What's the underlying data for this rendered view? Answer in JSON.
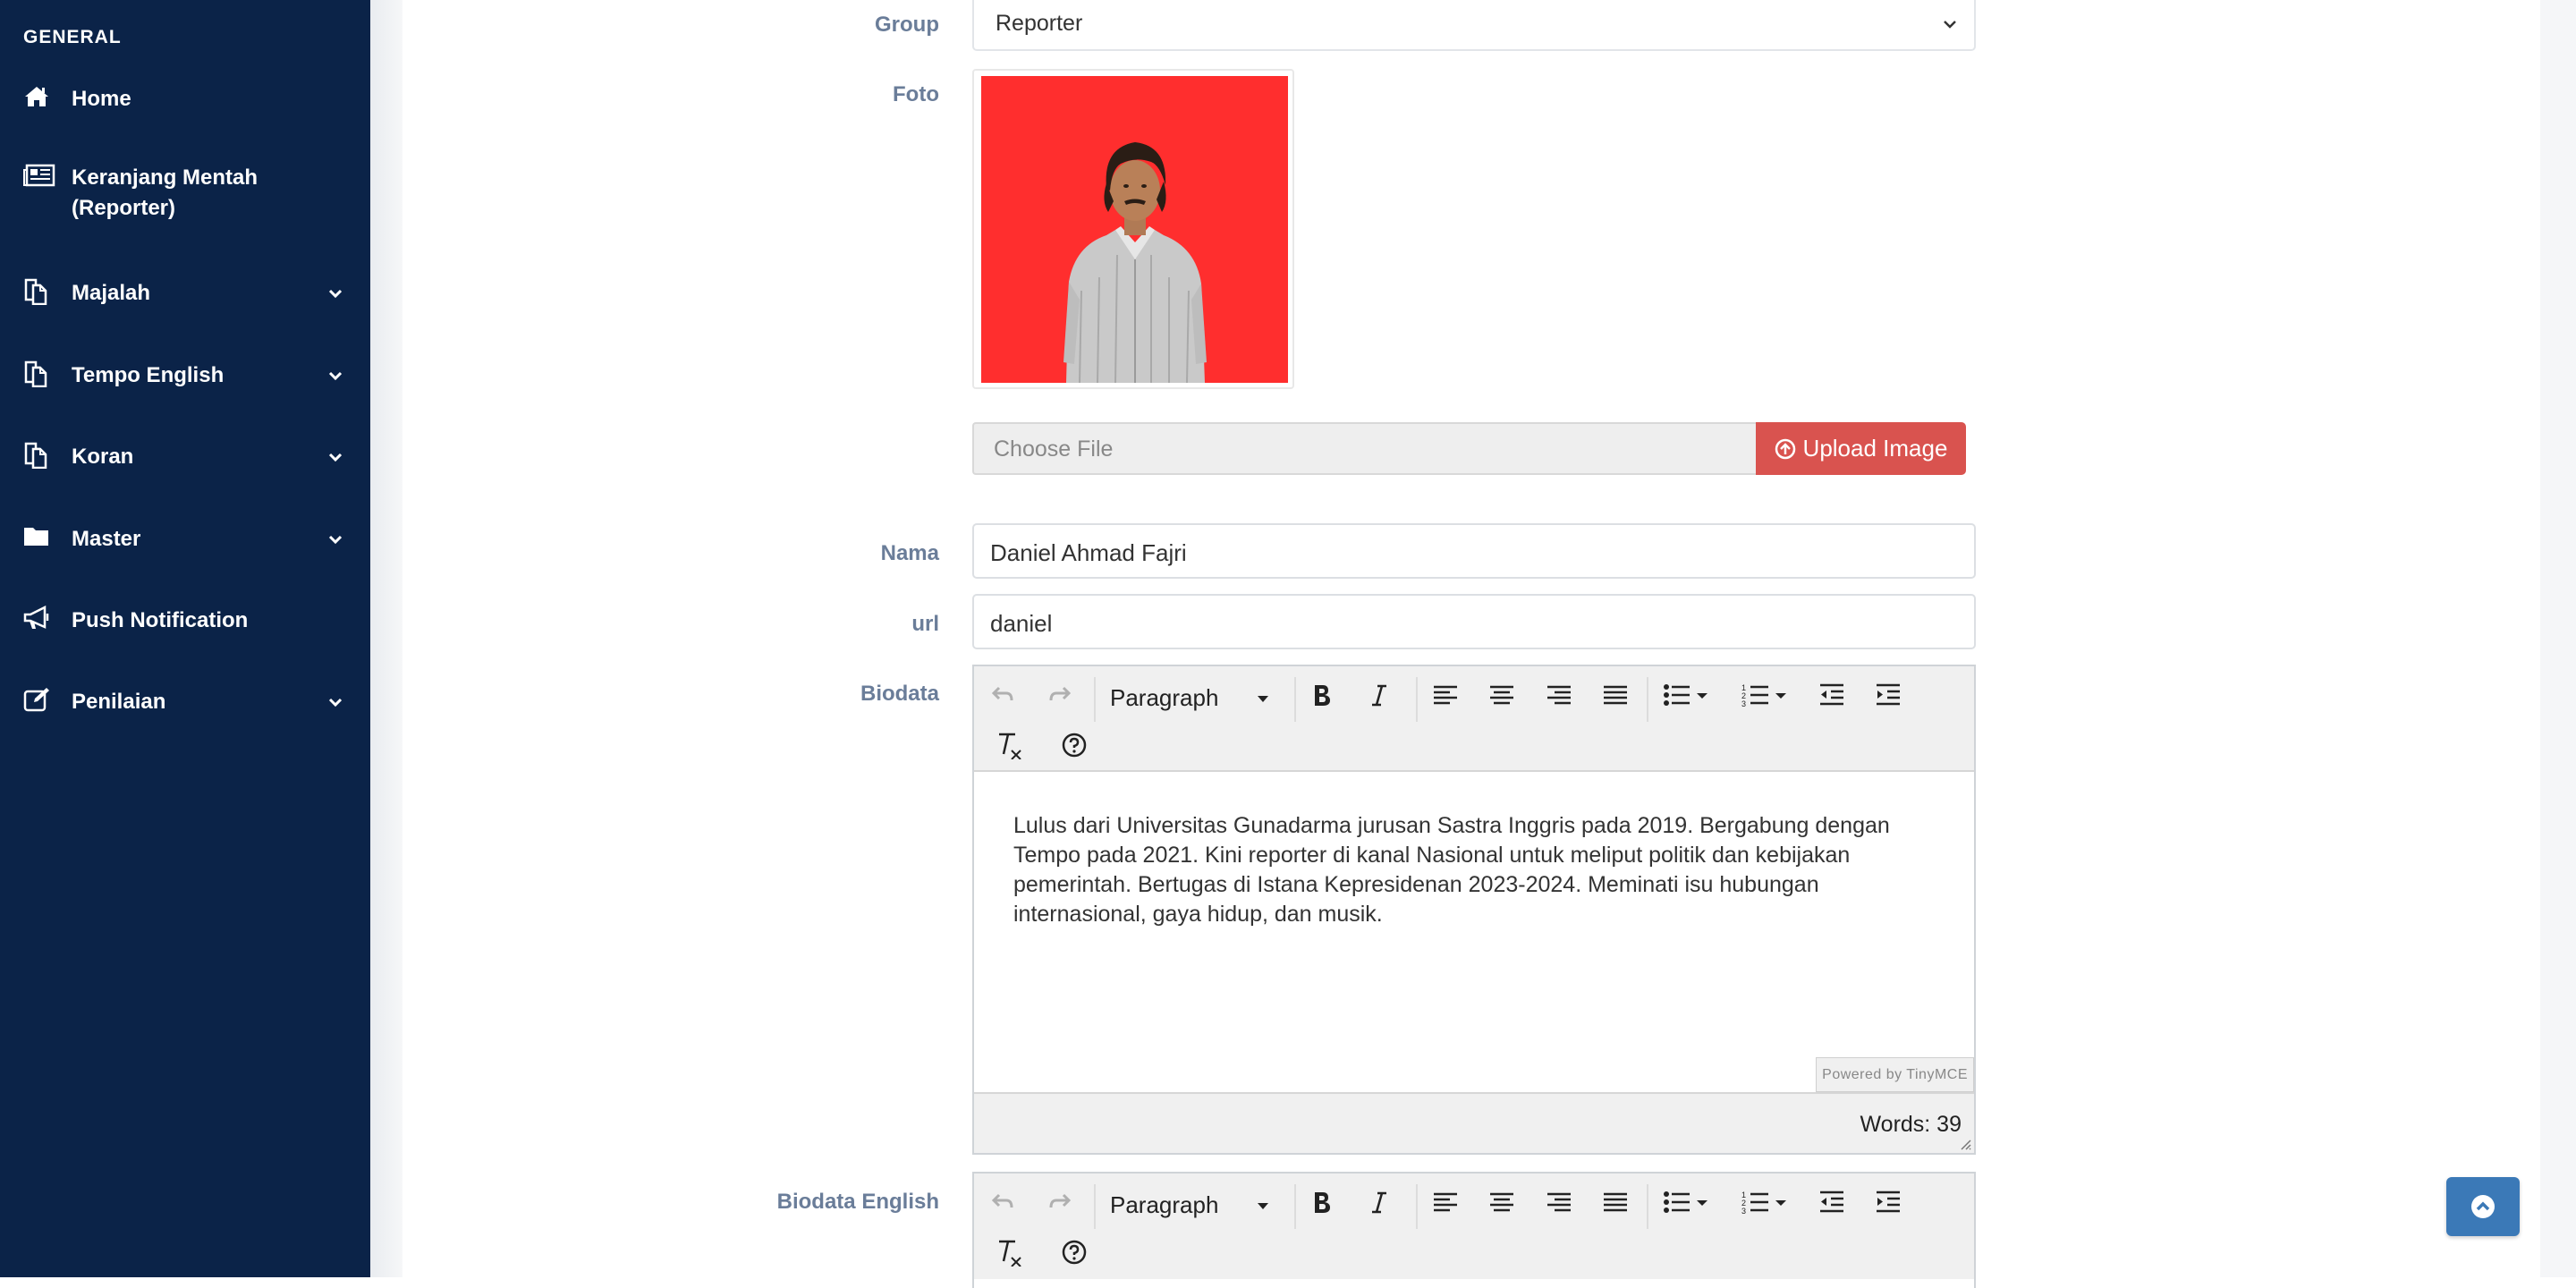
{
  "sidebar": {
    "heading": "GENERAL",
    "items": [
      {
        "label": "Home",
        "icon": "home-icon",
        "has_children": false
      },
      {
        "label": "Keranjang Mentah (Reporter)",
        "icon": "newspaper-icon",
        "has_children": false
      },
      {
        "label": "Majalah",
        "icon": "copy-icon",
        "has_children": true
      },
      {
        "label": "Tempo English",
        "icon": "copy-icon",
        "has_children": true
      },
      {
        "label": "Koran",
        "icon": "copy-icon",
        "has_children": true
      },
      {
        "label": "Master",
        "icon": "folder-icon",
        "has_children": true
      },
      {
        "label": "Push Notification",
        "icon": "bullhorn-icon",
        "has_children": false
      },
      {
        "label": "Penilaian",
        "icon": "edit-icon",
        "has_children": true
      }
    ]
  },
  "form": {
    "group": {
      "label": "Group",
      "value": "Reporter"
    },
    "foto": {
      "label": "Foto",
      "file_placeholder": "Choose File",
      "upload_label": "Upload Image"
    },
    "nama": {
      "label": "Nama",
      "value": "Daniel Ahmad Fajri"
    },
    "url": {
      "label": "url",
      "value": "daniel"
    },
    "biodata": {
      "label": "Biodata",
      "format": "Paragraph",
      "text": "Lulus dari Universitas Gunadarma jurusan Sastra Inggris pada 2019. Bergabung dengan Tempo pada 2021. Kini reporter di kanal Nasional untuk meliput politik dan kebijakan pemerintah. Bertugas di Istana Kepresidenan 2023-2024. Meminati isu hubungan internasional, gaya hidup, dan musik.",
      "powered_by": "Powered by TinyMCE",
      "word_count": "Words: 39"
    },
    "biodata_english": {
      "label": "Biodata English",
      "format": "Paragraph"
    }
  },
  "colors": {
    "sidebar_bg": "#0b2348",
    "label_text": "#6a7d99",
    "upload_button": "#d9534f",
    "photo_background": "#ff2e2e",
    "scroll_top_button": "#3b79b7"
  }
}
